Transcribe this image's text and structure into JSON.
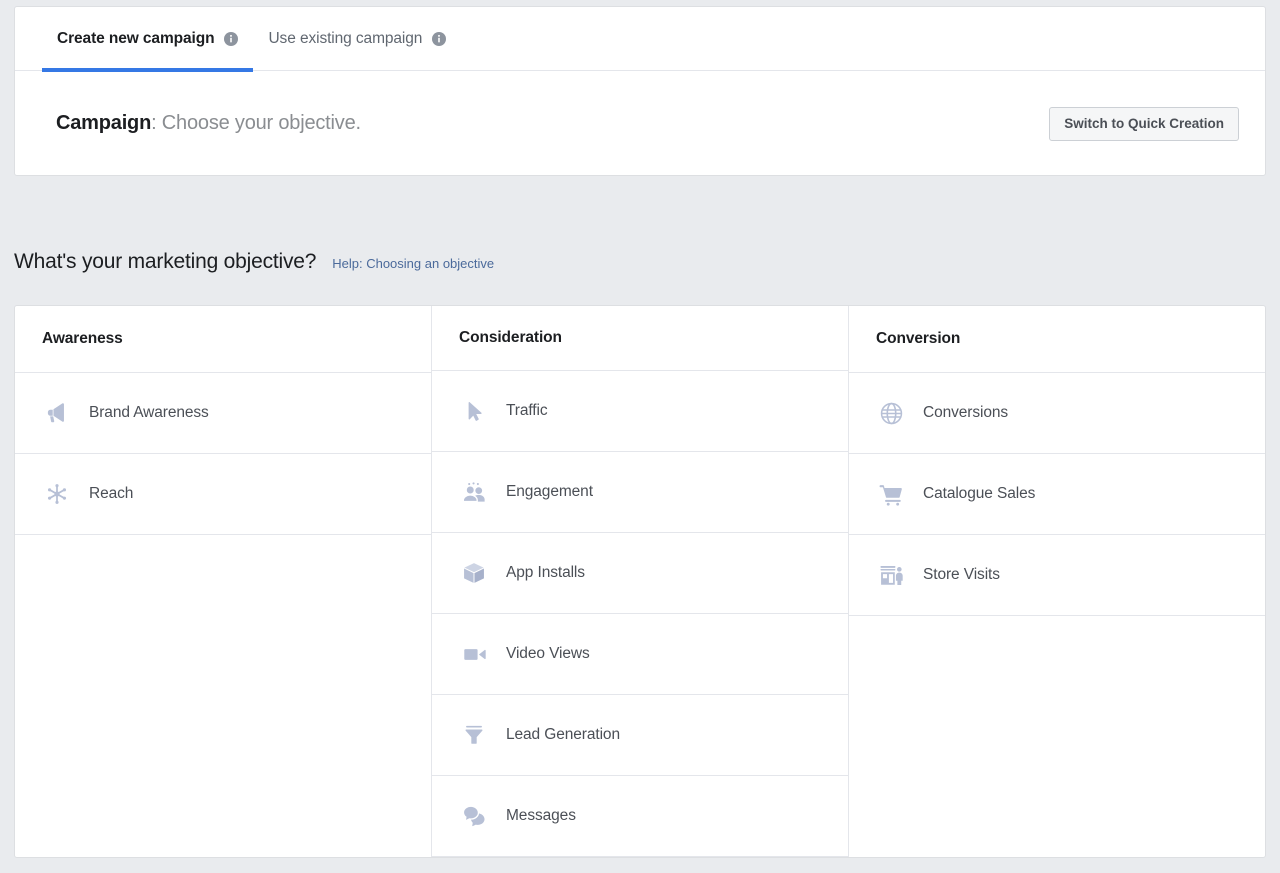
{
  "tabs": [
    {
      "label": "Create new campaign",
      "active": true,
      "info_icon": "info-icon"
    },
    {
      "label": "Use existing campaign",
      "active": false,
      "info_icon": "info-icon"
    }
  ],
  "campaign_header": {
    "label_bold": "Campaign",
    "label_rest": ": Choose your objective.",
    "switch_button": "Switch to Quick Creation"
  },
  "objective_section": {
    "heading": "What's your marketing objective?",
    "help_link": "Help: Choosing an objective"
  },
  "columns": [
    {
      "header": "Awareness",
      "items": [
        {
          "label": "Brand Awareness",
          "icon": "megaphone-icon"
        },
        {
          "label": "Reach",
          "icon": "reach-star-icon"
        }
      ]
    },
    {
      "header": "Consideration",
      "items": [
        {
          "label": "Traffic",
          "icon": "cursor-arrow-icon"
        },
        {
          "label": "Engagement",
          "icon": "people-group-icon"
        },
        {
          "label": "App Installs",
          "icon": "cube-box-icon"
        },
        {
          "label": "Video Views",
          "icon": "video-camera-icon"
        },
        {
          "label": "Lead Generation",
          "icon": "funnel-icon"
        },
        {
          "label": "Messages",
          "icon": "chat-bubbles-icon"
        }
      ]
    },
    {
      "header": "Conversion",
      "items": [
        {
          "label": "Conversions",
          "icon": "globe-icon"
        },
        {
          "label": "Catalogue Sales",
          "icon": "shopping-cart-icon"
        },
        {
          "label": "Store Visits",
          "icon": "storefront-icon"
        }
      ]
    }
  ],
  "colors": {
    "page_background": "#e9ebee",
    "card_background": "#ffffff",
    "border": "#dddfe2",
    "active_tab_underline": "#3578e5",
    "link": "#4b6a9b",
    "icon": "#b7c0d6",
    "text_primary": "#1c1e21",
    "text_secondary": "#4b4f56",
    "text_muted": "#8a8d91"
  }
}
